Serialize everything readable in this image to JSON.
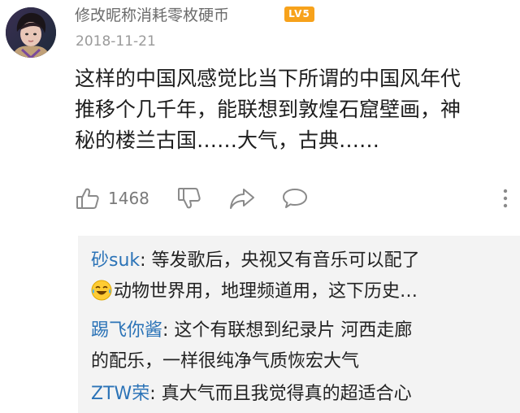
{
  "comment": {
    "username": "修改昵称消耗零枚硬币",
    "level_badge": "LV5",
    "date": "2018-11-21",
    "text_lines": [
      "这样的中国风感觉比当下所谓的中国风年代",
      "推移个几千年，能联想到敦煌石窟壁画，神",
      "秘的楼兰古国……大气，古典……"
    ]
  },
  "actions": {
    "like_count": "1468",
    "icons": [
      "thumbs-up-icon",
      "thumbs-down-icon",
      "share-icon",
      "comment-icon",
      "more-icon"
    ]
  },
  "replies": [
    {
      "author": "砂suk",
      "text": ": 等发歌后，央视又有音乐可以配了"
    },
    {
      "continuation": "动物世界用，地理频道用，这下历史…",
      "emoji": "laughing-tears-emoji"
    },
    {
      "author": "踢飞你酱",
      "text": ": 这个有联想到纪录片 河西走廊"
    },
    {
      "continuation": "的配乐，一样很纯净气质恢宏大气"
    },
    {
      "author": "ZTW荣",
      "text": ": 真大气而且我觉得真的超适合心"
    }
  ],
  "colors": {
    "author_link": "#2b73b7",
    "badge": "#f7a21b",
    "reply_bg": "#f3f3f3",
    "icon_gray": "#8a8a8a"
  }
}
